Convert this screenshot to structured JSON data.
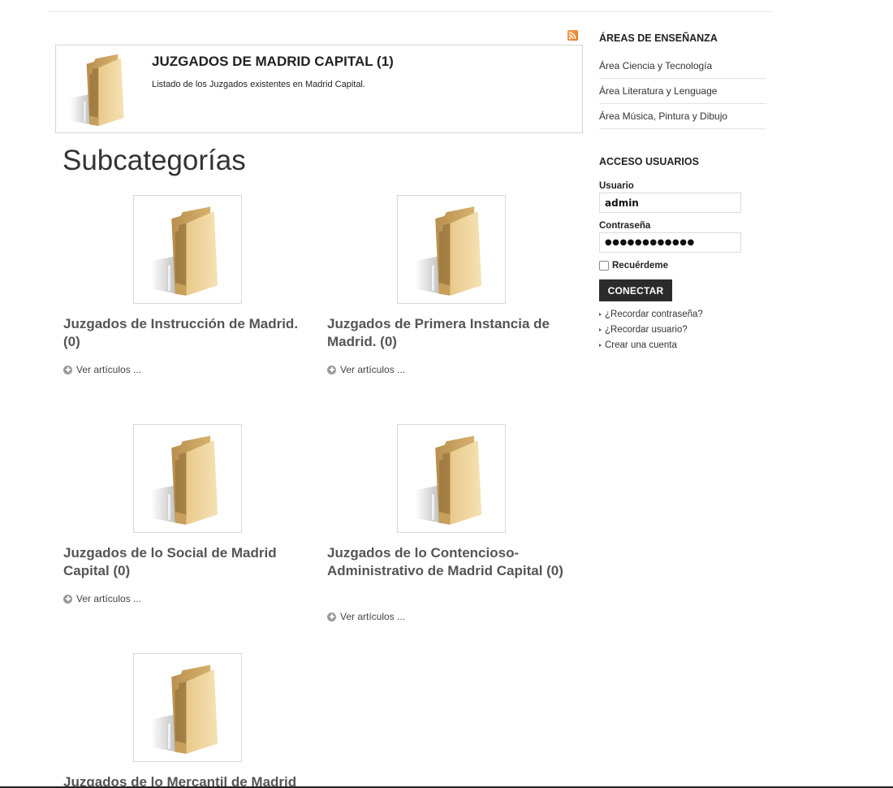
{
  "category": {
    "title": "JUZGADOS DE MADRID CAPITAL (1)",
    "description": "Listado de los Juzgados existentes en Madrid Capital."
  },
  "subcategories": {
    "heading": "Subcategorías",
    "read_more": "Ver artículos ...",
    "items": [
      {
        "title": "Juzgados de Instrucción de Madrid. (0)"
      },
      {
        "title": "Juzgados de Primera Instancia de Madrid. (0)"
      },
      {
        "title": "Juzgados de lo Social de Madrid Capital (0)"
      },
      {
        "title": "Juzgados de lo Contencioso-Administrativo de Madrid Capital (0)"
      },
      {
        "title": "Juzgados de lo Mercantil de Madrid"
      }
    ]
  },
  "sidebar": {
    "areas": {
      "heading": "ÁREAS DE ENSEÑANZA",
      "items": [
        {
          "label": "Área Ciencia y Tecnología"
        },
        {
          "label": "Área Literatura y Lenguage"
        },
        {
          "label": "Área Música, Pintura y Dibujo"
        }
      ]
    },
    "login": {
      "heading": "ACCESO USUARIOS",
      "username_label": "Usuario",
      "username_value": "admin",
      "password_label": "Contraseña",
      "password_value": "●●●●●●●●●●●●",
      "remember_label": "Recuérdeme",
      "submit_label": "CONECTAR",
      "links": [
        {
          "label": "¿Recordar contraseña?"
        },
        {
          "label": "¿Recordar usuario?"
        },
        {
          "label": "Crear una cuenta"
        }
      ]
    }
  },
  "icons": {
    "rss": "rss-icon",
    "folder": "folder-icon",
    "read_more": "plus-circle-icon",
    "link_bullet": "arrow-right-icon"
  },
  "colors": {
    "rss": "#e6781e",
    "folder": "#d9b06c",
    "button": "#2b2b2b"
  }
}
